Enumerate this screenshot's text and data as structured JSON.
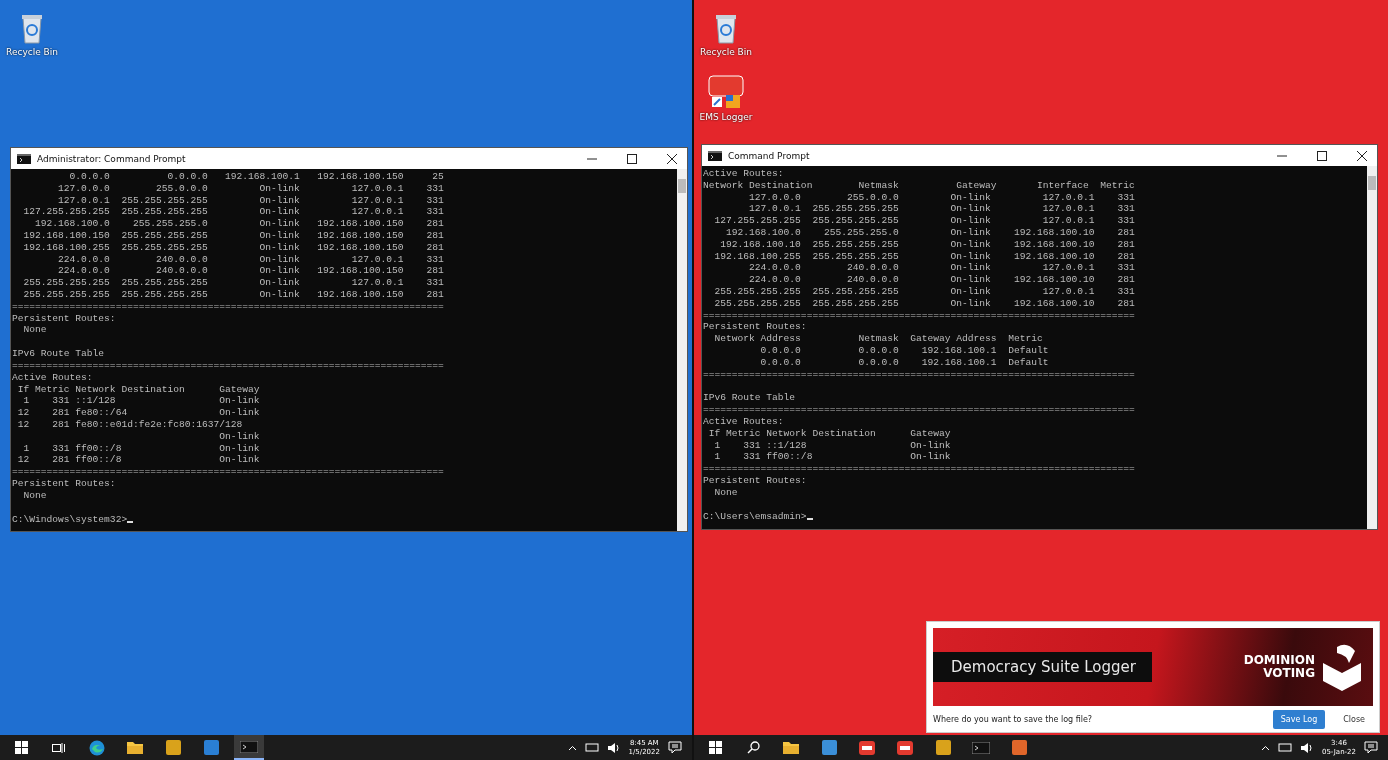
{
  "desktops": [
    {
      "color": "#1f6fd1",
      "icons": [
        {
          "kind": "recycle",
          "label": "Recycle Bin"
        }
      ],
      "window": {
        "title": "Administrator: Command Prompt",
        "blocks": [
          [
            "          0.0.0.0          0.0.0.0   192.168.100.1   192.168.100.150     25",
            "        127.0.0.0        255.0.0.0         On-link         127.0.0.1    331",
            "        127.0.0.1  255.255.255.255         On-link         127.0.0.1    331",
            "  127.255.255.255  255.255.255.255         On-link         127.0.0.1    331",
            "    192.168.100.0    255.255.255.0         On-link   192.168.100.150    281",
            "  192.168.100.150  255.255.255.255         On-link   192.168.100.150    281",
            "  192.168.100.255  255.255.255.255         On-link   192.168.100.150    281",
            "        224.0.0.0        240.0.0.0         On-link         127.0.0.1    331",
            "        224.0.0.0        240.0.0.0         On-link   192.168.100.150    281",
            "  255.255.255.255  255.255.255.255         On-link         127.0.0.1    331",
            "  255.255.255.255  255.255.255.255         On-link   192.168.100.150    281",
            "===========================================================================",
            "Persistent Routes:",
            "  None"
          ],
          [
            "IPv6 Route Table",
            "===========================================================================",
            "Active Routes:",
            " If Metric Network Destination      Gateway",
            "  1    331 ::1/128                  On-link",
            " 12    281 fe80::/64                On-link",
            " 12    281 fe80::e01d:fe2e:fc80:1637/128",
            "                                    On-link",
            "  1    331 ff00::/8                 On-link",
            " 12    281 ff00::/8                 On-link",
            "===========================================================================",
            "Persistent Routes:",
            "  None"
          ],
          [
            "C:\\Windows\\system32>"
          ]
        ]
      },
      "taskbar": {
        "apps": [
          {
            "kind": "start",
            "active": false
          },
          {
            "kind": "taskview",
            "active": false
          },
          {
            "kind": "browser",
            "active": false
          },
          {
            "kind": "folder",
            "active": false
          },
          {
            "kind": "app",
            "color": "#d9a21b",
            "active": false
          },
          {
            "kind": "app",
            "color": "#2a7fd4",
            "active": false
          },
          {
            "kind": "terminal",
            "active": true
          }
        ],
        "tray": {
          "time": "8:45 AM",
          "date": "1/5/2022"
        }
      }
    },
    {
      "color": "#e4262b",
      "icons": [
        {
          "kind": "recycle",
          "label": "Recycle Bin"
        },
        {
          "kind": "log",
          "label": "EMS Logger"
        }
      ],
      "window": {
        "title": "Command Prompt",
        "blocks": [
          [
            "Active Routes:",
            "Network Destination        Netmask          Gateway       Interface  Metric",
            "        127.0.0.0        255.0.0.0         On-link         127.0.0.1    331",
            "        127.0.0.1  255.255.255.255         On-link         127.0.0.1    331",
            "  127.255.255.255  255.255.255.255         On-link         127.0.0.1    331",
            "    192.168.100.0    255.255.255.0         On-link    192.168.100.10    281",
            "   192.168.100.10  255.255.255.255         On-link    192.168.100.10    281",
            "  192.168.100.255  255.255.255.255         On-link    192.168.100.10    281",
            "        224.0.0.0        240.0.0.0         On-link         127.0.0.1    331",
            "        224.0.0.0        240.0.0.0         On-link    192.168.100.10    281",
            "  255.255.255.255  255.255.255.255         On-link         127.0.0.1    331",
            "  255.255.255.255  255.255.255.255         On-link    192.168.100.10    281",
            "===========================================================================",
            "Persistent Routes:",
            "  Network Address          Netmask  Gateway Address  Metric",
            "          0.0.0.0          0.0.0.0    192.168.100.1  Default",
            "          0.0.0.0          0.0.0.0    192.168.100.1  Default",
            "==========================================================================="
          ],
          [
            "IPv6 Route Table",
            "===========================================================================",
            "Active Routes:",
            " If Metric Network Destination      Gateway",
            "  1    331 ::1/128                  On-link",
            "  1    331 ff00::/8                 On-link",
            "===========================================================================",
            "Persistent Routes:",
            "  None"
          ],
          [
            "C:\\Users\\emsadmin>"
          ]
        ]
      },
      "taskbar": {
        "apps": [
          {
            "kind": "start",
            "active": false
          },
          {
            "kind": "search",
            "active": false
          },
          {
            "kind": "folder",
            "active": false
          },
          {
            "kind": "app",
            "color": "#3b8fd8",
            "active": false
          },
          {
            "kind": "log",
            "active": false
          },
          {
            "kind": "log",
            "active": false
          },
          {
            "kind": "app",
            "color": "#d9a21b",
            "active": false
          },
          {
            "kind": "terminal",
            "active": false
          },
          {
            "kind": "app",
            "color": "#e0662a",
            "active": false
          }
        ],
        "tray": {
          "time": "3:46",
          "date": "05-Jan-22"
        }
      },
      "popup": {
        "title": "Democracy Suite Logger",
        "logo": [
          "DOMINION",
          "VOTING"
        ],
        "message": "Where do you want to save the log file?",
        "buttons": [
          {
            "label": "Save Log",
            "primary": true
          },
          {
            "label": "Close",
            "primary": false
          }
        ]
      }
    }
  ]
}
